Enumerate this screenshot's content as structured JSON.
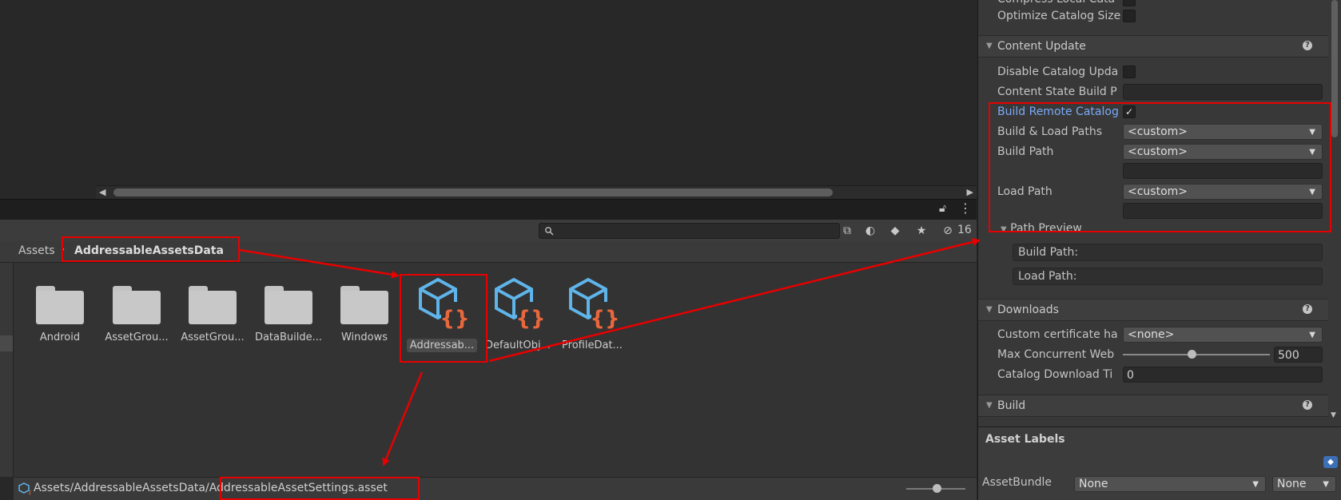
{
  "project": {
    "breadcrumb": [
      "Assets",
      "AddressableAssetsData"
    ],
    "hidden_count": "16",
    "items": [
      {
        "label": "Android",
        "kind": "folder"
      },
      {
        "label": "AssetGrou...",
        "kind": "folder"
      },
      {
        "label": "AssetGrou...",
        "kind": "folder"
      },
      {
        "label": "DataBuilde...",
        "kind": "folder"
      },
      {
        "label": "Windows",
        "kind": "folder"
      },
      {
        "label": "Addressab...",
        "kind": "asset",
        "selected": true
      },
      {
        "label": "DefaultObj...",
        "kind": "asset"
      },
      {
        "label": "ProfileDat...",
        "kind": "asset"
      }
    ],
    "status_path_prefix": "Assets/AddressableAssetsData/",
    "status_path_file": "AddressableAssetSettings.asset"
  },
  "inspector": {
    "top_rows": {
      "compress_local_catalog": "Compress Local Cata",
      "optimize_catalog_size": "Optimize Catalog Size"
    },
    "content_update": {
      "title": "Content Update",
      "disable_catalog_update": "Disable Catalog Upda",
      "content_state_build_path": "Content State Build P",
      "build_remote_catalog": "Build Remote Catalog",
      "build_load_paths": "Build & Load Paths",
      "build_load_paths_value": "<custom>",
      "build_path": "Build Path",
      "build_path_value": "<custom>",
      "load_path": "Load Path",
      "load_path_value": "<custom>",
      "path_preview": "Path Preview",
      "build_path_preview": "Build Path:",
      "load_path_preview": "Load Path:"
    },
    "downloads": {
      "title": "Downloads",
      "custom_certificate": "Custom certificate ha",
      "custom_certificate_value": "<none>",
      "max_concurrent": "Max Concurrent Web",
      "max_concurrent_value": "500",
      "max_concurrent_fraction": 0.47,
      "catalog_timeout": "Catalog Download Ti",
      "catalog_timeout_value": "0"
    },
    "build": {
      "title": "Build"
    },
    "asset_labels": {
      "title": "Asset Labels",
      "assetbundle": "AssetBundle",
      "bundle_value": "None",
      "variant_value": "None"
    }
  },
  "colors": {
    "highlight": "#e80000",
    "accent_text": "#7baaf7",
    "asset_blue": "#5fb4ea",
    "asset_orange": "#e8673c"
  }
}
